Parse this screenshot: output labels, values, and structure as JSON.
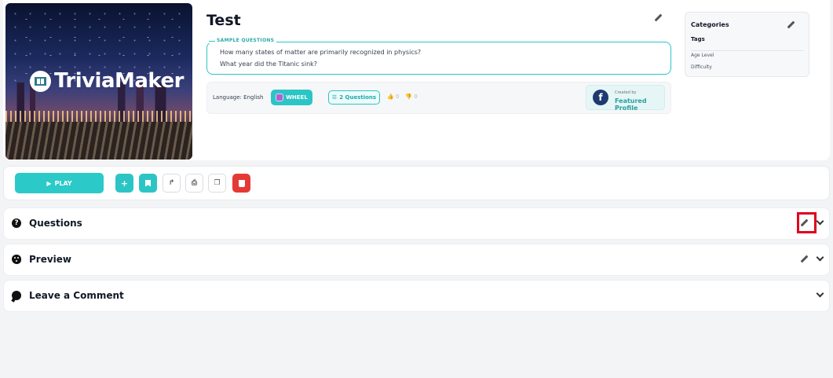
{
  "cover": {
    "logo_text": "TriviaMaker",
    "logo_icon": "grid-board-icon"
  },
  "header": {
    "title": "Test"
  },
  "sample_questions": {
    "legend": "SAMPLE QUESTIONS",
    "items": [
      "How many states of matter are primarily recognized in physics?",
      "What year did the Titanic sink?"
    ]
  },
  "info": {
    "language_label": "Language:",
    "language_value": "English",
    "mode": "WHEEL",
    "questions": "2 Questions",
    "likes": "0",
    "dislikes": "0"
  },
  "creator": {
    "created_by": "Created by",
    "name": "Featured Profile",
    "icon": "facebook-icon"
  },
  "sidebar": {
    "categories": "Categories",
    "tags": "Tags",
    "age_level": "Age Level",
    "difficulty": "Difficulty"
  },
  "actions": {
    "play": "PLAY",
    "icons": [
      "plus-icon",
      "bookmark-icon",
      "share-icon",
      "print-icon",
      "copy-icon",
      "trash-icon"
    ]
  },
  "sections": [
    {
      "label": "Questions",
      "icon": "question-circle-icon"
    },
    {
      "label": "Preview",
      "icon": "palette-icon"
    },
    {
      "label": "Leave a Comment",
      "icon": "comment-icon"
    }
  ],
  "colors": {
    "accent": "#2cc5c5",
    "danger": "#e53935",
    "highlight": "#e0001b",
    "facebook": "#1e3a6e"
  }
}
